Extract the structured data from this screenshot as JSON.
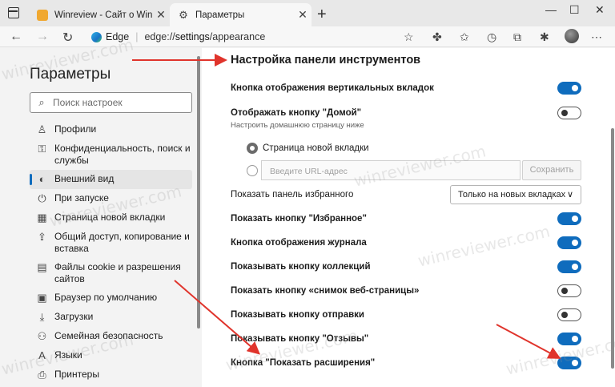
{
  "tabs": [
    {
      "title": "Winreview - Сайт о Windows",
      "favicon_color": "#f0a830"
    },
    {
      "title": "Параметры"
    }
  ],
  "window": {
    "minimize": "—",
    "maximize": "☐",
    "close": "✕",
    "new_tab": "+"
  },
  "address_bar": {
    "brand": "Edge",
    "separator": "|",
    "url_prefix": "edge://",
    "url_bold": "settings",
    "url_rest": "/appearance"
  },
  "sidebar": {
    "title": "Параметры",
    "search_placeholder": "Поиск настроек",
    "items": [
      {
        "label": "Профили",
        "icon": "person-icon"
      },
      {
        "label": "Конфиденциальность, поиск и службы",
        "icon": "lock-icon"
      },
      {
        "label": "Внешний вид",
        "icon": "palette-icon",
        "selected": true
      },
      {
        "label": "При запуске",
        "icon": "power-icon"
      },
      {
        "label": "Страница новой вкладки",
        "icon": "grid-icon"
      },
      {
        "label": "Общий доступ, копирование и вставка",
        "icon": "share-icon"
      },
      {
        "label": "Файлы cookie и разрешения сайтов",
        "icon": "cookie-icon"
      },
      {
        "label": "Браузер по умолчанию",
        "icon": "browser-icon"
      },
      {
        "label": "Загрузки",
        "icon": "download-icon"
      },
      {
        "label": "Семейная безопасность",
        "icon": "family-icon"
      },
      {
        "label": "Языки",
        "icon": "language-icon"
      },
      {
        "label": "Принтеры",
        "icon": "printer-icon"
      }
    ]
  },
  "main": {
    "section_title": "Настройка панели инструментов",
    "vertical_tabs": {
      "label": "Кнопка отображения вертикальных вкладок",
      "on": true
    },
    "home": {
      "label": "Отображать кнопку \"Домой\"",
      "on": false,
      "sub": "Настроить домашнюю страницу ниже"
    },
    "radio_new_tab": "Страница новой вкладки",
    "url_placeholder": "Введите URL-адрес",
    "save": "Сохранить",
    "favorites_bar": {
      "label": "Показать панель избранного",
      "value": "Только на новых вкладках"
    },
    "toggles": [
      {
        "label": "Показать кнопку \"Избранное\"",
        "on": true
      },
      {
        "label": "Кнопка отображения журнала",
        "on": true
      },
      {
        "label": "Показывать кнопку коллекций",
        "on": true
      },
      {
        "label": "Показать кнопку «снимок веб-страницы»",
        "on": false
      },
      {
        "label": "Показывать кнопку отправки",
        "on": false
      },
      {
        "label": "Показывать кнопку \"Отзывы\"",
        "on": true
      },
      {
        "label": "Кнопка \"Показать расширения\"",
        "on": true
      }
    ]
  },
  "watermark": "winreviewer.com",
  "colors": {
    "accent": "#0f6cbd",
    "arrow": "#e0342c"
  }
}
